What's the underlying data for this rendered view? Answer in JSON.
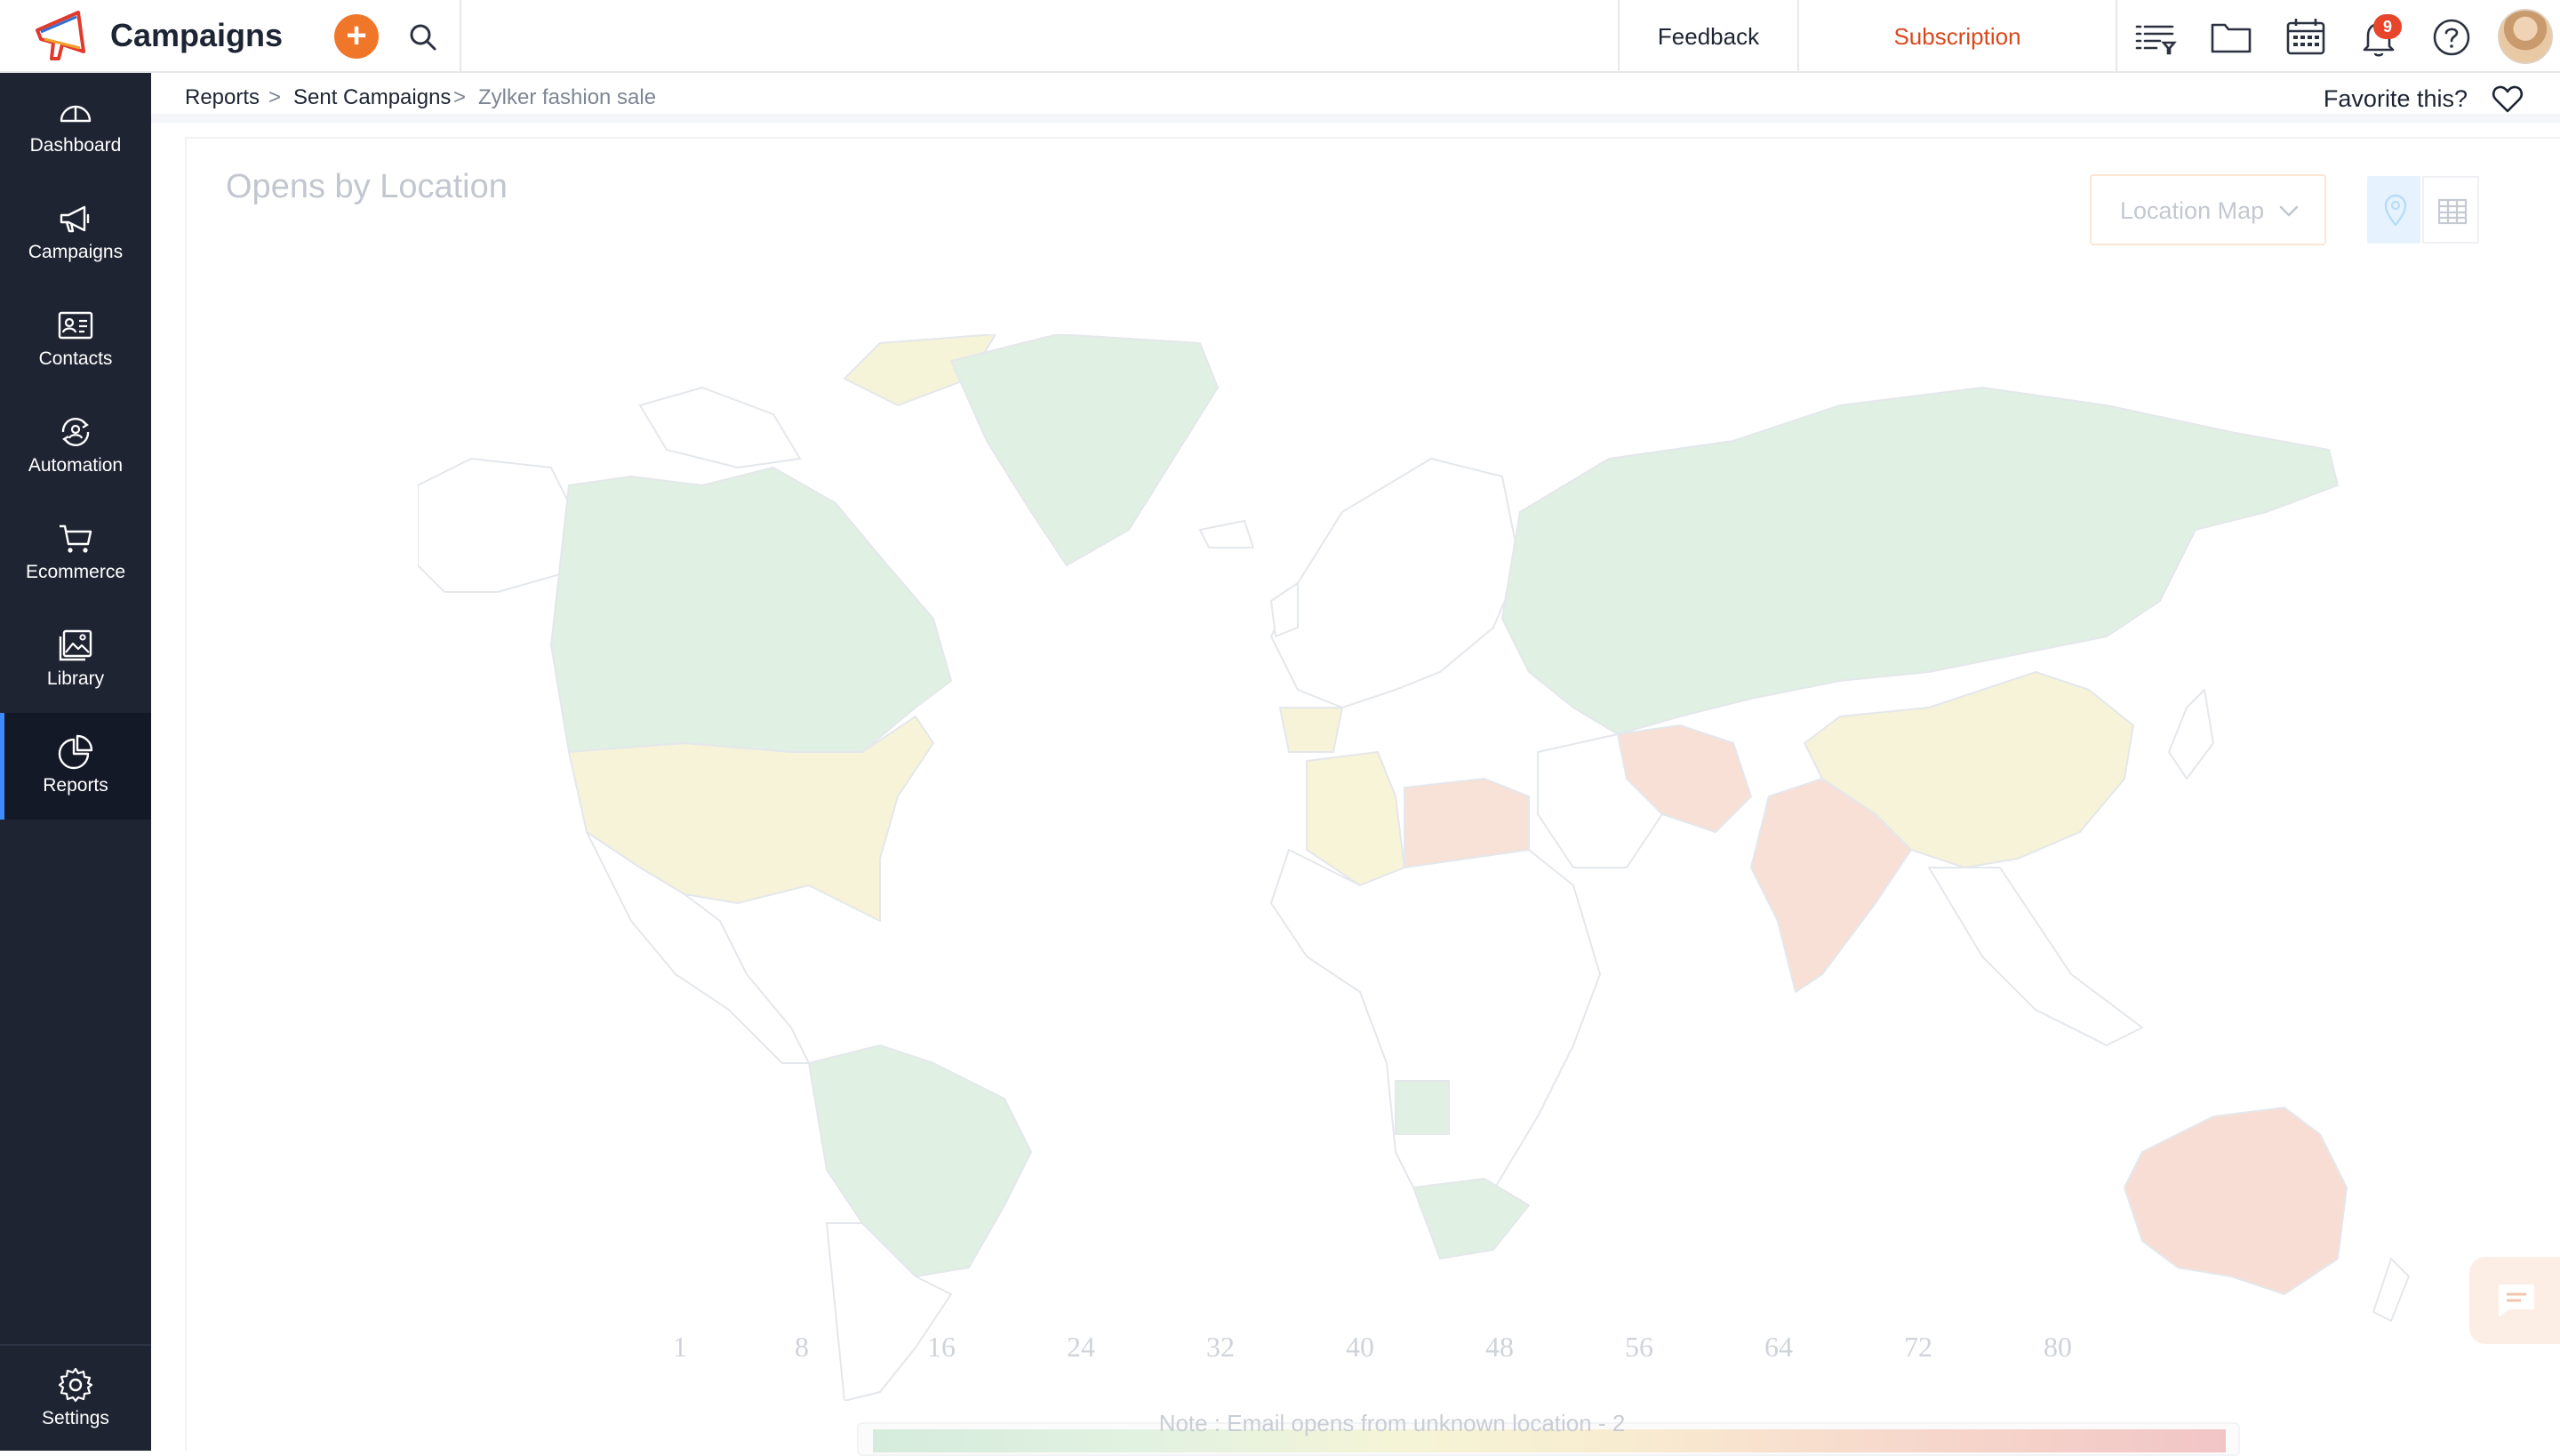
{
  "topbar": {
    "app_name": "Campaigns",
    "feedback_label": "Feedback",
    "subscription_label": "Subscription",
    "notification_count": "9",
    "icons": [
      "campaigns-logo-icon",
      "plus-icon",
      "search-icon",
      "list-filter-icon",
      "folder-icon",
      "calendar-icon",
      "bell-icon",
      "help-icon"
    ]
  },
  "sidebar": {
    "items": [
      {
        "label": "Dashboard",
        "icon": "gauge-icon"
      },
      {
        "label": "Campaigns",
        "icon": "megaphone-icon"
      },
      {
        "label": "Contacts",
        "icon": "contact-card-icon"
      },
      {
        "label": "Automation",
        "icon": "automation-icon"
      },
      {
        "label": "Ecommerce",
        "icon": "cart-icon"
      },
      {
        "label": "Library",
        "icon": "image-library-icon"
      },
      {
        "label": "Reports",
        "icon": "pie-chart-icon"
      }
    ],
    "active": "Reports",
    "settings_label": "Settings"
  },
  "breadcrumb": {
    "items": [
      "Reports",
      "Sent Campaigns",
      "Zylker fashion sale"
    ],
    "separator": ">"
  },
  "favorite": {
    "label": "Favorite this?"
  },
  "panel": {
    "title": "Opens by Location",
    "view_select": "Location Map",
    "view_toggle_active": "map"
  },
  "legend": {
    "ticks": [
      "1",
      "8",
      "16",
      "24",
      "32",
      "40",
      "48",
      "56",
      "64",
      "72",
      "80"
    ],
    "colors": [
      "#d5ebdc",
      "#f6f4d6",
      "#f7d9cc",
      "#f1c5c5"
    ]
  },
  "note": "Note : Email opens from unknown location - 2",
  "colors": {
    "sidebar_bg": "#1e2432",
    "accent_orange": "#f0772a",
    "subscription_red": "#d9481c",
    "active_indicator": "#3d8bfd"
  }
}
